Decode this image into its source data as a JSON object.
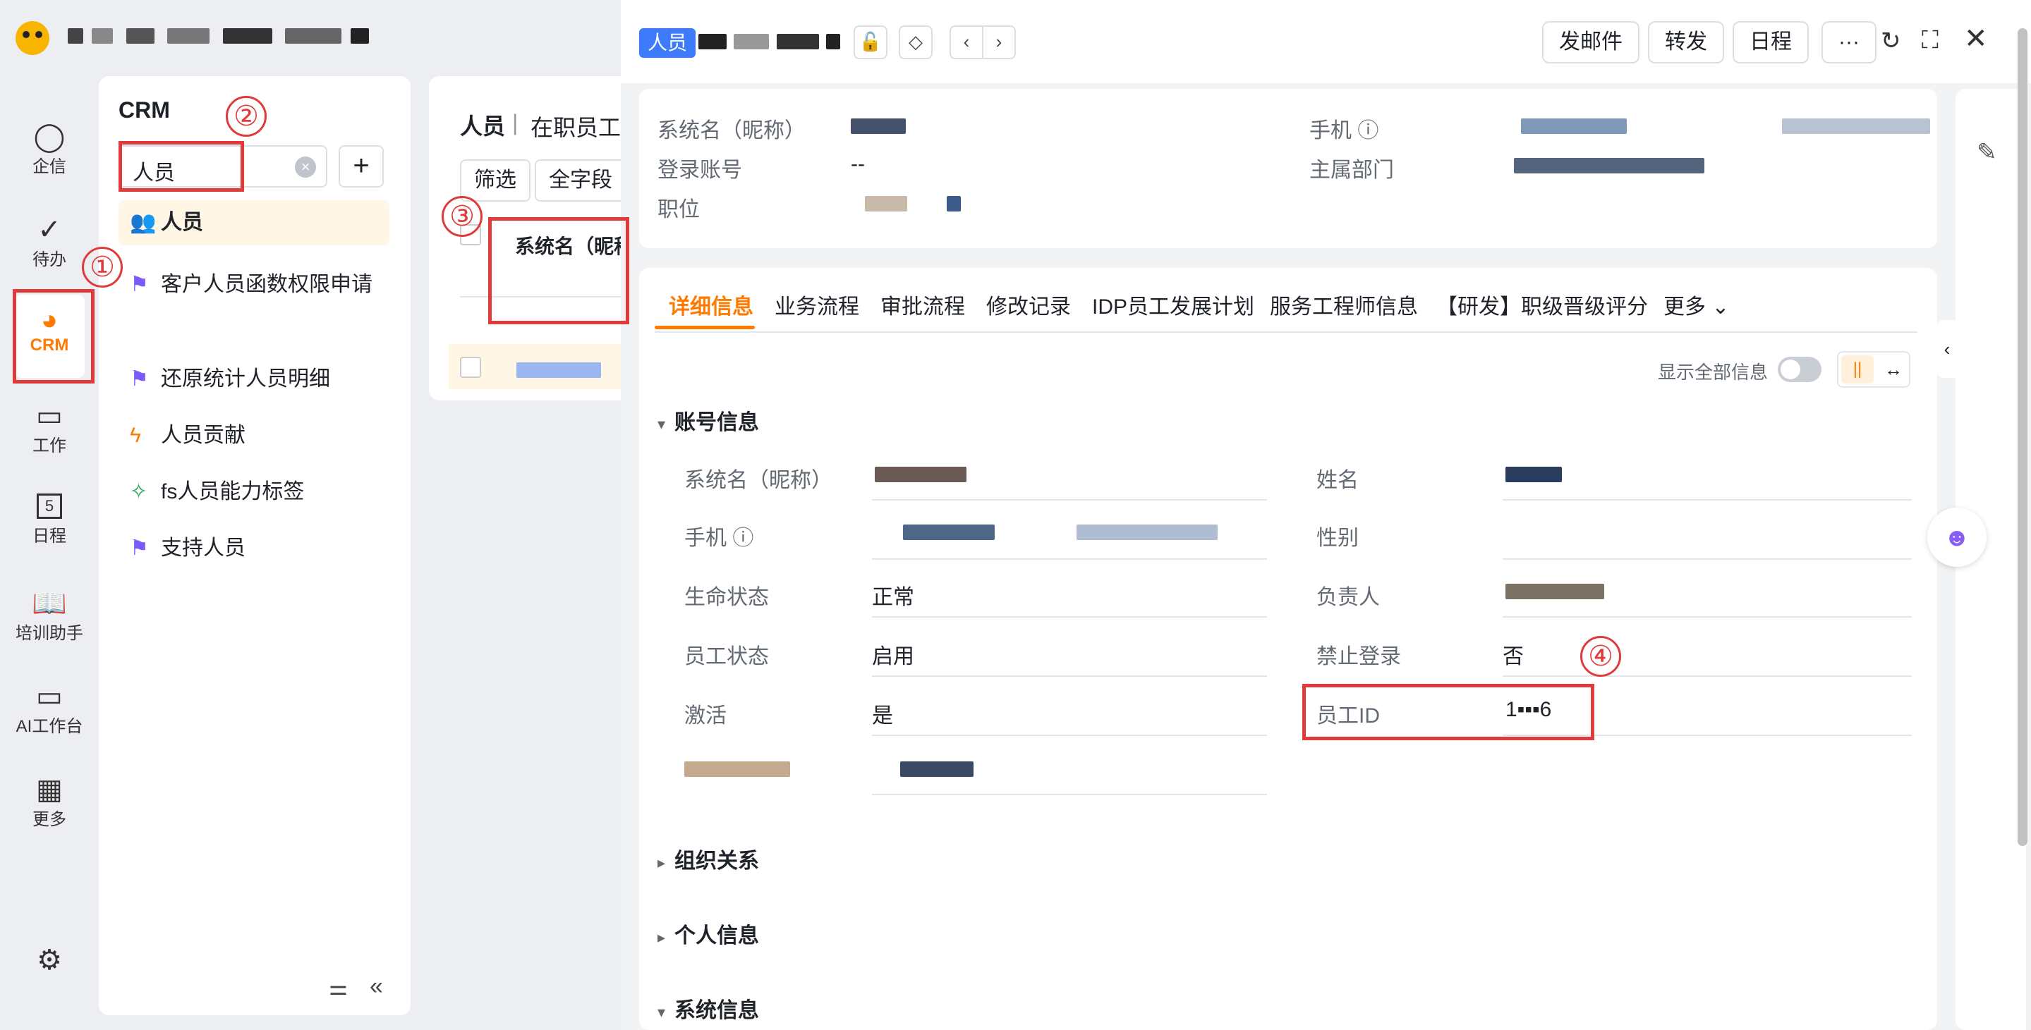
{
  "app": {
    "nav": [
      {
        "label": "企信",
        "icon": "chat-bubble-icon"
      },
      {
        "label": "待办",
        "icon": "check-circle-icon"
      },
      {
        "label": "CRM",
        "icon": "pie-chart-icon"
      },
      {
        "label": "工作",
        "icon": "briefcase-icon"
      },
      {
        "label": "日程",
        "icon": "calendar-icon",
        "day": "5"
      },
      {
        "label": "培训助手",
        "icon": "book-icon"
      },
      {
        "label": "AI工作台",
        "icon": "laptop-icon"
      },
      {
        "label": "更多",
        "icon": "grid-icon"
      }
    ]
  },
  "crm_panel": {
    "title": "CRM",
    "search_value": "人员",
    "items": [
      {
        "label": "人员",
        "icon": "users-icon"
      },
      {
        "label": "客户人员函数权限申请",
        "icon": "flag-icon"
      },
      {
        "label": "还原统计人员明细",
        "icon": "flag-icon"
      },
      {
        "label": "人员贡献",
        "icon": "lightning-icon"
      },
      {
        "label": "fs人员能力标签",
        "icon": "pin-icon"
      },
      {
        "label": "支持人员",
        "icon": "flag-icon"
      }
    ]
  },
  "list_panel": {
    "title": "人员",
    "view": "在职员工",
    "filter_label": "筛选",
    "fields_label": "全字段",
    "column_header": "系统名（昵称）"
  },
  "detail": {
    "tag": "人员",
    "actions": {
      "email": "发邮件",
      "forward": "转发",
      "schedule": "日程",
      "more": "···"
    },
    "summary": {
      "system_name_label": "系统名（昵称）",
      "login_label": "登录账号",
      "login_value": "--",
      "position_label": "职位",
      "phone_label": "手机",
      "dept_label": "主属部门"
    },
    "tabs": [
      "详细信息",
      "业务流程",
      "审批流程",
      "修改记录",
      "IDP员工发展计划",
      "服务工程师信息",
      "【研发】职级晋级评分",
      "更多"
    ],
    "show_all_label": "显示全部信息",
    "sections": {
      "account": "账号信息",
      "org": "组织关系",
      "personal": "个人信息",
      "system": "系统信息"
    },
    "fields": {
      "system_name": "系统名（昵称）",
      "phone": "手机",
      "life_status": "生命状态",
      "life_status_value": "正常",
      "emp_status": "员工状态",
      "emp_status_value": "启用",
      "activated": "激活",
      "activated_value": "是",
      "name": "姓名",
      "gender": "性别",
      "owner": "负责人",
      "login_forbidden": "禁止登录",
      "login_forbidden_value": "否",
      "emp_id": "员工ID",
      "emp_id_value": "1▪▪▪6"
    }
  },
  "annotations": [
    "①",
    "②",
    "③",
    "④"
  ],
  "colors": {
    "accent": "#ff7a00",
    "tag_blue": "#3e7bfa",
    "highlight_red": "#e03b3b"
  }
}
